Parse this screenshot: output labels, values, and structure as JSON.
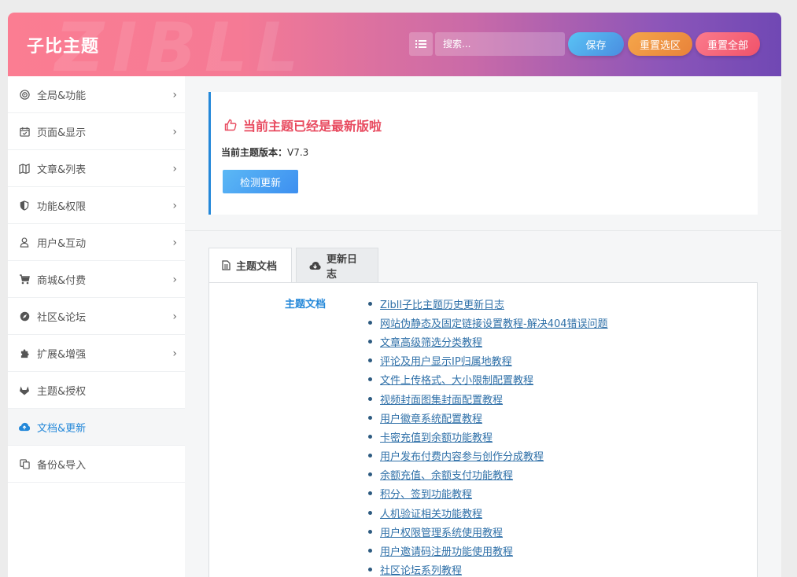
{
  "header": {
    "brand": "子比主题",
    "watermark": "ZIBLL",
    "search_placeholder": "搜索...",
    "save_label": "保存",
    "reset_section_label": "重置选区",
    "reset_all_label": "重置全部"
  },
  "sidebar": {
    "items": [
      {
        "label": "全局&功能",
        "icon": "target-icon"
      },
      {
        "label": "页面&显示",
        "icon": "calendar-icon"
      },
      {
        "label": "文章&列表",
        "icon": "map-icon"
      },
      {
        "label": "功能&权限",
        "icon": "shield-icon"
      },
      {
        "label": "用户&互动",
        "icon": "user-icon"
      },
      {
        "label": "商城&付费",
        "icon": "cart-icon"
      },
      {
        "label": "社区&论坛",
        "icon": "compass-icon"
      },
      {
        "label": "扩展&增强",
        "icon": "puzzle-icon"
      },
      {
        "label": "主题&授权",
        "icon": "gitlab-icon"
      },
      {
        "label": "文档&更新",
        "icon": "cloud-icon"
      },
      {
        "label": "备份&导入",
        "icon": "copy-icon"
      }
    ],
    "active_index": 9
  },
  "update": {
    "title": "当前主题已经是最新版啦",
    "version_label": "当前主题版本：",
    "version_value": "V7.3",
    "check_button": "检测更新"
  },
  "tabs": [
    {
      "label": "主题文档",
      "icon": "file-icon",
      "active": true
    },
    {
      "label": "更新日志",
      "icon": "cloud-download-icon",
      "active": false
    }
  ],
  "docs": {
    "section_label": "主题文档",
    "links": [
      "Zibll子比主题历史更新日志",
      "网站伪静态及固定链接设置教程-解决404错误问题",
      "文章高级筛选分类教程",
      "评论及用户显示IP归属地教程",
      "文件上传格式、大小限制配置教程",
      "视频封面图集封面配置教程",
      "用户徽章系统配置教程",
      "卡密充值到余额功能教程",
      "用户发布付费内容参与创作分成教程",
      "余额充值、余额支付功能教程",
      "积分、签到功能教程",
      "人机验证相关功能教程",
      "用户权限管理系统使用教程",
      "用户邀请码注册功能使用教程",
      "社区论坛系列教程"
    ]
  },
  "colors": {
    "accent": "#2488d9",
    "title_red": "#e84a5f",
    "link": "#2f70a8"
  }
}
